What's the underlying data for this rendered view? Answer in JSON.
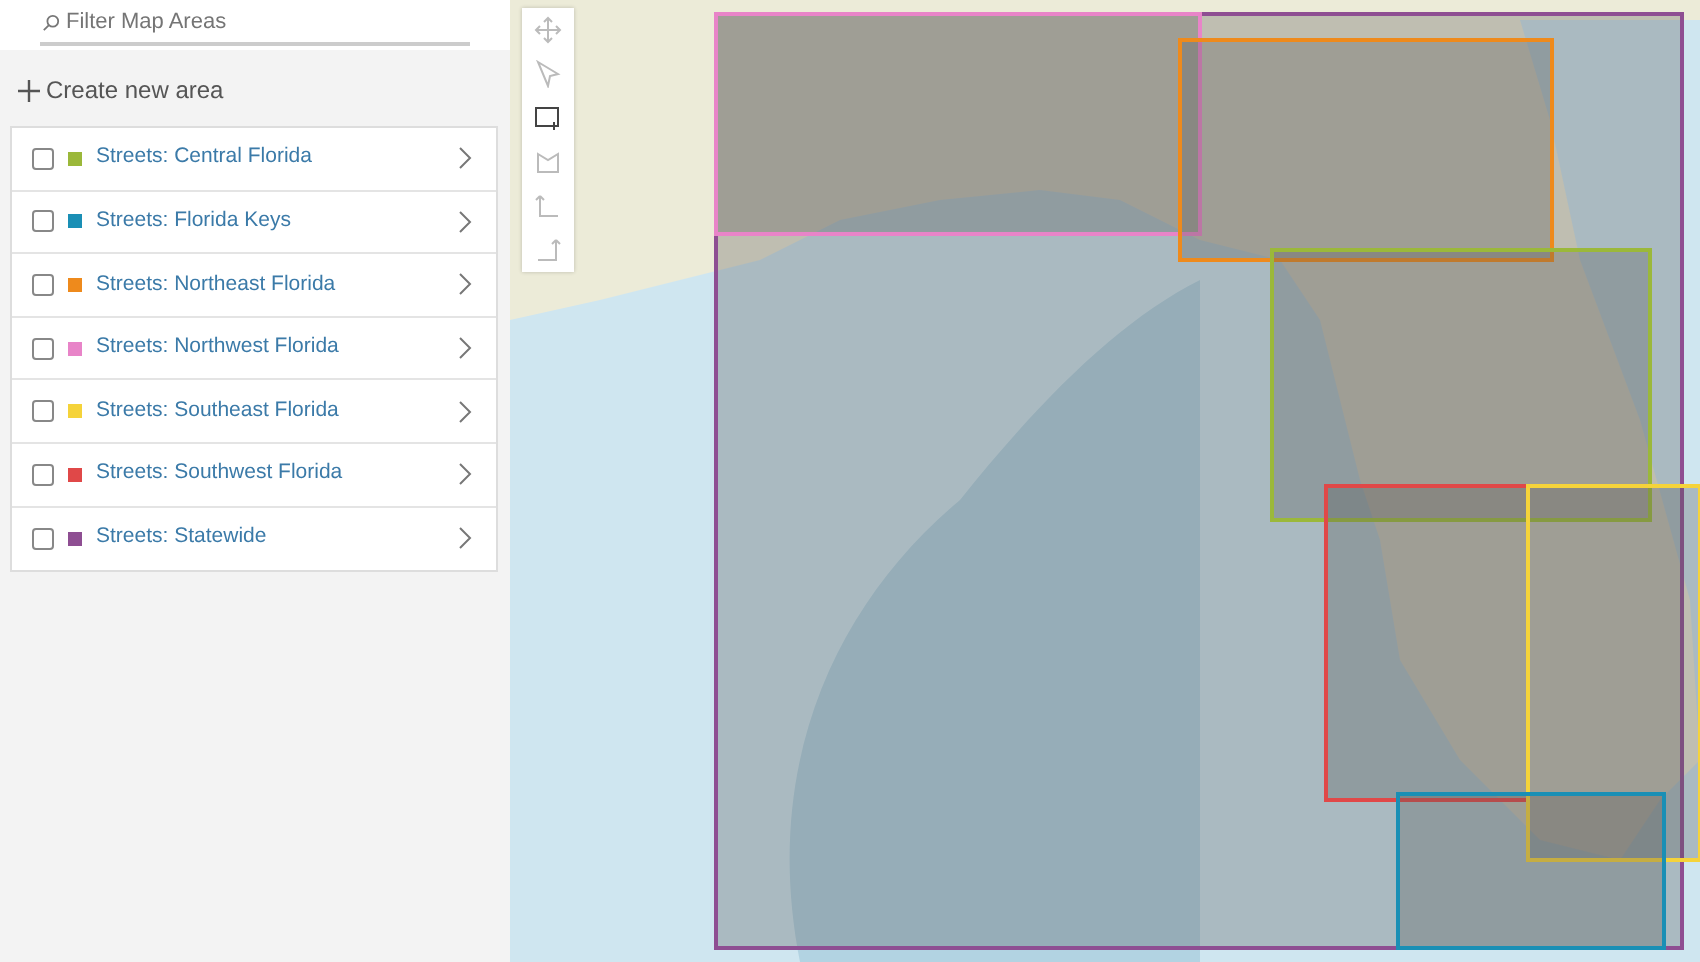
{
  "filter": {
    "placeholder": "Filter Map Areas"
  },
  "create_button": {
    "label": "Create new area"
  },
  "areas": [
    {
      "label": "Streets: Central Florida",
      "checked": false,
      "color": "#9bb83a"
    },
    {
      "label": "Streets: Florida Keys",
      "checked": false,
      "color": "#1a8fb5"
    },
    {
      "label": "Streets: Northeast Florida",
      "checked": false,
      "color": "#ee8a1c"
    },
    {
      "label": "Streets: Northwest Florida",
      "checked": false,
      "color": "#e884c8"
    },
    {
      "label": "Streets: Southeast Florida",
      "checked": false,
      "color": "#f5d33a"
    },
    {
      "label": "Streets: Southwest Florida",
      "checked": false,
      "color": "#e04848"
    },
    {
      "label": "Streets: Statewide",
      "checked": false,
      "color": "#8e4e92"
    }
  ]
}
